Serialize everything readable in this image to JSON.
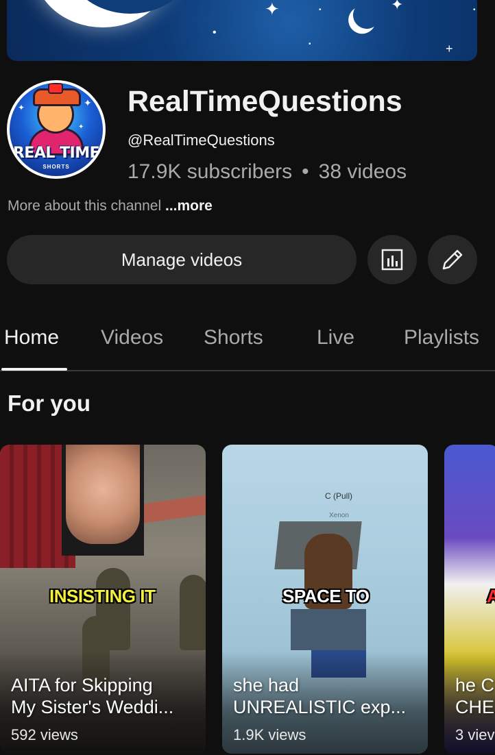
{
  "channel": {
    "name": "RealTimeQuestions",
    "handle": "@RealTimeQuestions",
    "subscribers": "17.9K subscribers",
    "separator": "•",
    "videos": "38 videos",
    "about_prefix": "More about this channel",
    "about_more": "...more",
    "avatar_text": "REAL TIME",
    "avatar_subtext": "SHORTS"
  },
  "actions": {
    "manage_videos": "Manage videos",
    "analytics_icon": "analytics-icon",
    "edit_icon": "pencil-icon"
  },
  "tabs": [
    {
      "label": "Home",
      "active": true
    },
    {
      "label": "Videos",
      "active": false
    },
    {
      "label": "Shorts",
      "active": false
    },
    {
      "label": "Live",
      "active": false
    },
    {
      "label": "Playlists",
      "active": false
    }
  ],
  "section": {
    "title": "For you"
  },
  "shorts": [
    {
      "overlay": "INSISTING IT",
      "overlay_color": "#f5f03a",
      "title_line1": "AITA for Skipping",
      "title_line2": "My Sister's Weddi...",
      "views": "592 views"
    },
    {
      "overlay": "SPACE TO",
      "overlay_color": "#ffffff",
      "tag1": "C (Pull)",
      "tag2": "Xenon",
      "title_line1": "she had",
      "title_line2": "UNREALISTIC exp...",
      "views": "1.9K views"
    },
    {
      "overlay": "A",
      "overlay_color": "#ff2a2a",
      "title_line1": "he C",
      "title_line2": "CHE",
      "views": "3 viev"
    }
  ],
  "colors": {
    "background": "#0f0f0f",
    "button_bg": "#272727",
    "text_primary": "#f1f1f1",
    "text_secondary": "#aaaaaa"
  }
}
